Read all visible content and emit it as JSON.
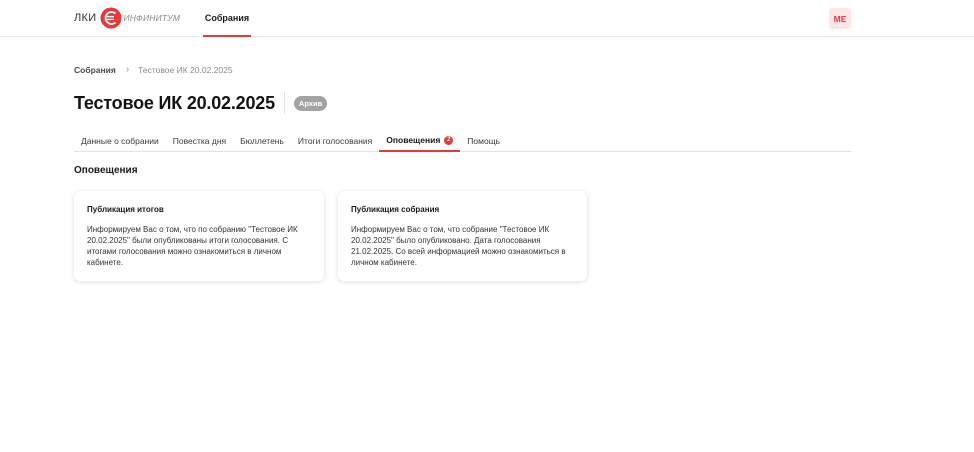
{
  "header": {
    "brand_prefix": "ЛКИ",
    "brand_name": "ИНФИНИТУМ",
    "nav_item": "Собрания",
    "avatar_initials": "МЕ",
    "accent_color": "#e53a3a"
  },
  "breadcrumb": {
    "root": "Собрания",
    "separator": "›",
    "current": "Тестовое ИК 20.02.2025"
  },
  "page": {
    "title": "Тестовое ИК 20.02.2025",
    "status": "Архив"
  },
  "tabs": [
    {
      "label": "Данные о собрании",
      "active": false
    },
    {
      "label": "Повестка дня",
      "active": false
    },
    {
      "label": "Бюллетень",
      "active": false
    },
    {
      "label": "Итоги голосования",
      "active": false
    },
    {
      "label": "Оповещения",
      "active": true,
      "count": "2"
    },
    {
      "label": "Помощь",
      "active": false
    }
  ],
  "section": {
    "title": "Оповещения"
  },
  "notifications": [
    {
      "title": "Публикация итогов",
      "body": "Информируем Вас о том, что по собранию \"Тестовое ИК 20.02.2025\" были опубликованы итоги голосования. С итогами голосования можно ознакомиться в личном кабинете."
    },
    {
      "title": "Публикация собрания",
      "body": "Информируем Вас о том, что собрание \"Тестовое ИК 20.02.2025\" было опубликовано. Дата голосования 21.02.2025. Со всей информацией можно ознакомиться в личном кабинете."
    }
  ]
}
